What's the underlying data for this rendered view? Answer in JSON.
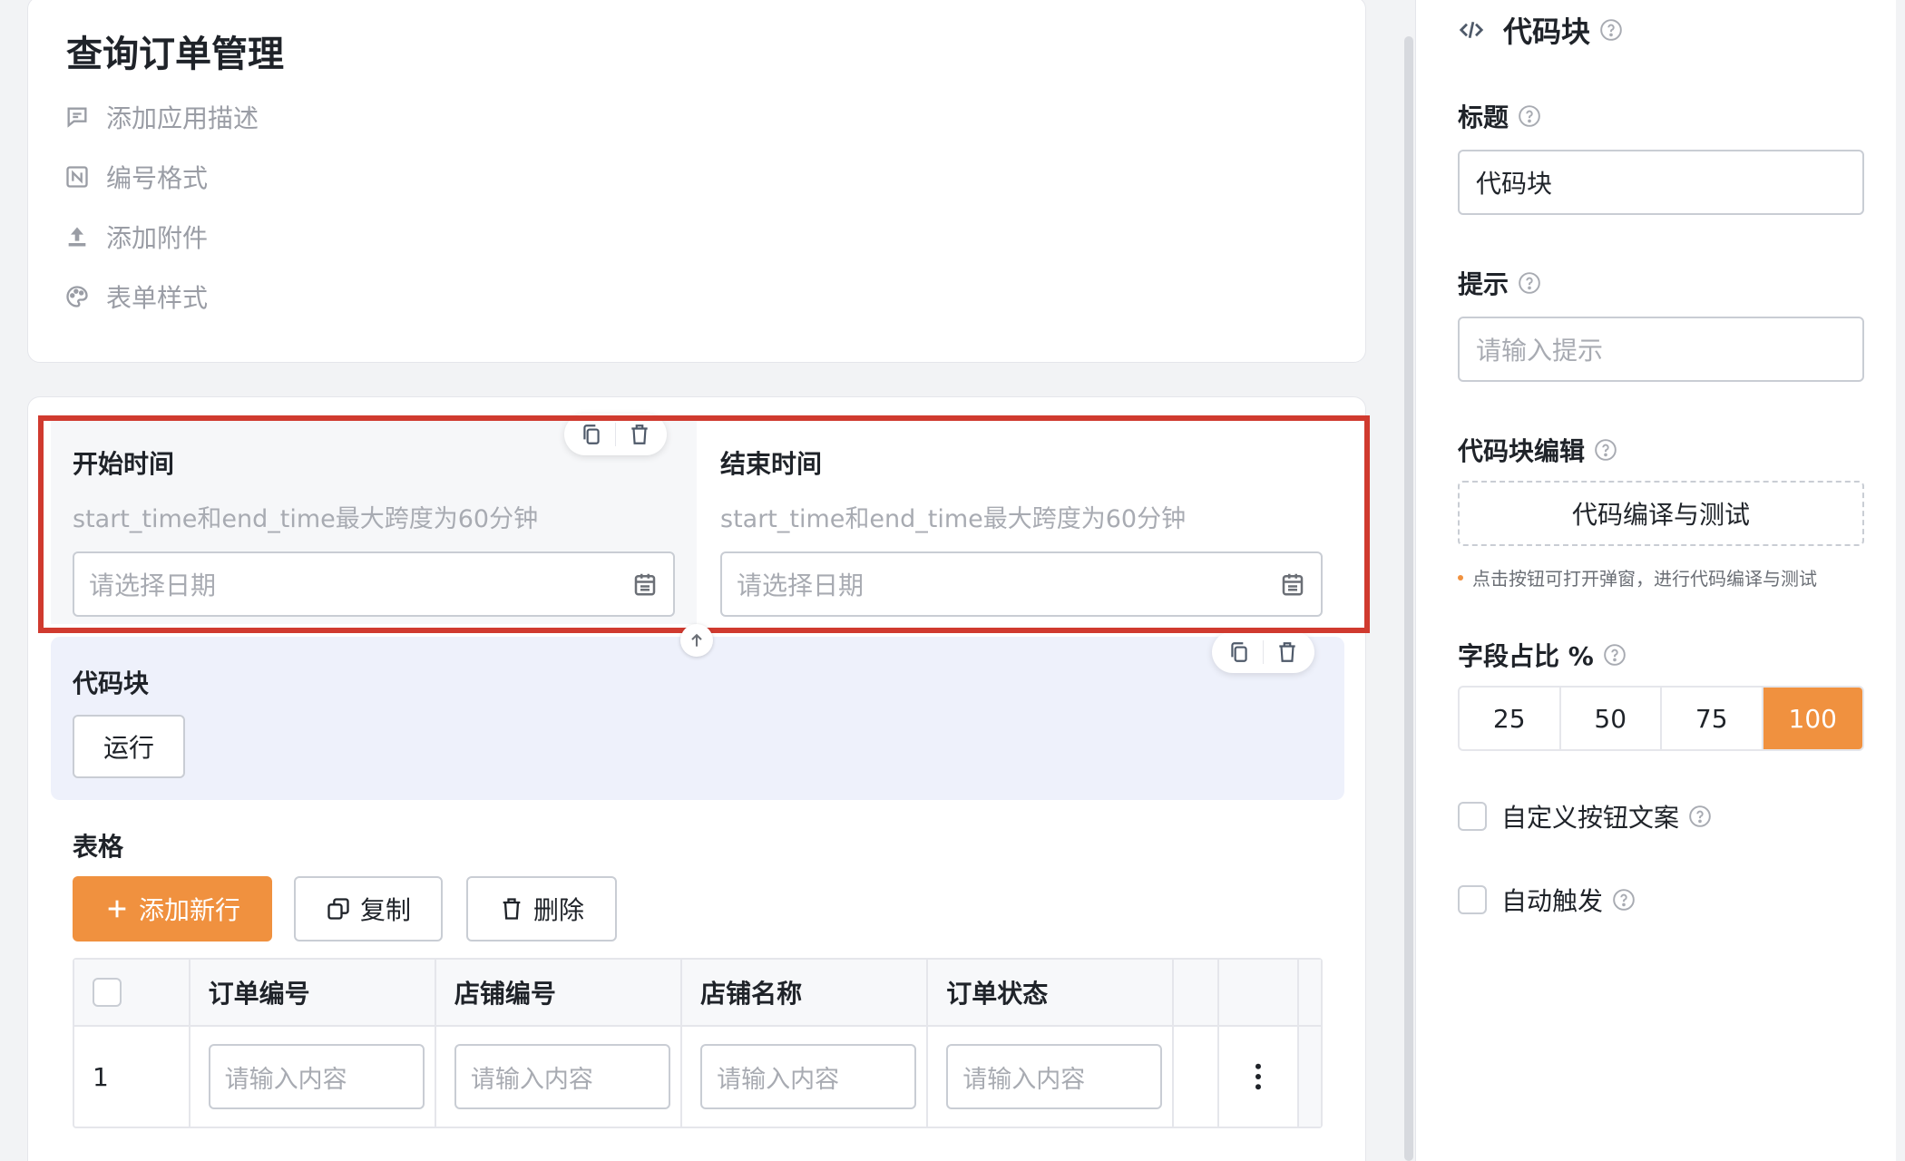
{
  "form": {
    "title": "查询订单管理",
    "meta_items": [
      {
        "label": "添加应用描述",
        "icon": "comment-icon"
      },
      {
        "label": "编号格式",
        "icon": "number-format-icon"
      },
      {
        "label": "添加附件",
        "icon": "upload-icon"
      },
      {
        "label": "表单样式",
        "icon": "palette-icon"
      }
    ]
  },
  "fields": {
    "start": {
      "label": "开始时间",
      "desc": "start_time和end_time最大跨度为60分钟",
      "placeholder": "请选择日期"
    },
    "end": {
      "label": "结束时间",
      "desc": "start_time和end_time最大跨度为60分钟",
      "placeholder": "请选择日期"
    },
    "code": {
      "label": "代码块",
      "run_label": "运行"
    }
  },
  "table": {
    "label": "表格",
    "add_label": "添加新行",
    "copy_label": "复制",
    "delete_label": "删除",
    "columns": [
      "订单编号",
      "店铺编号",
      "店铺名称",
      "订单状态"
    ],
    "rows": [
      {
        "num": "1",
        "placeholders": [
          "请输入内容",
          "请输入内容",
          "请输入内容",
          "请输入内容"
        ]
      }
    ]
  },
  "panel": {
    "title": "代码块",
    "title_label": "标题",
    "title_value": "代码块",
    "hint_label": "提示",
    "hint_placeholder": "请输入提示",
    "code_edit_label": "代码块编辑",
    "code_edit_button": "代码编译与测试",
    "code_edit_tip": "点击按钮可打开弹窗，进行代码编译与测试",
    "ratio_label": "字段占比 %",
    "ratio_options": [
      "25",
      "50",
      "75",
      "100"
    ],
    "ratio_selected": "100",
    "custom_button_label": "自定义按钮文案",
    "auto_trigger_label": "自动触发"
  },
  "colors": {
    "accent": "#f0913f",
    "highlight": "#d03a2f",
    "code_field_bg": "#eef1fb"
  }
}
